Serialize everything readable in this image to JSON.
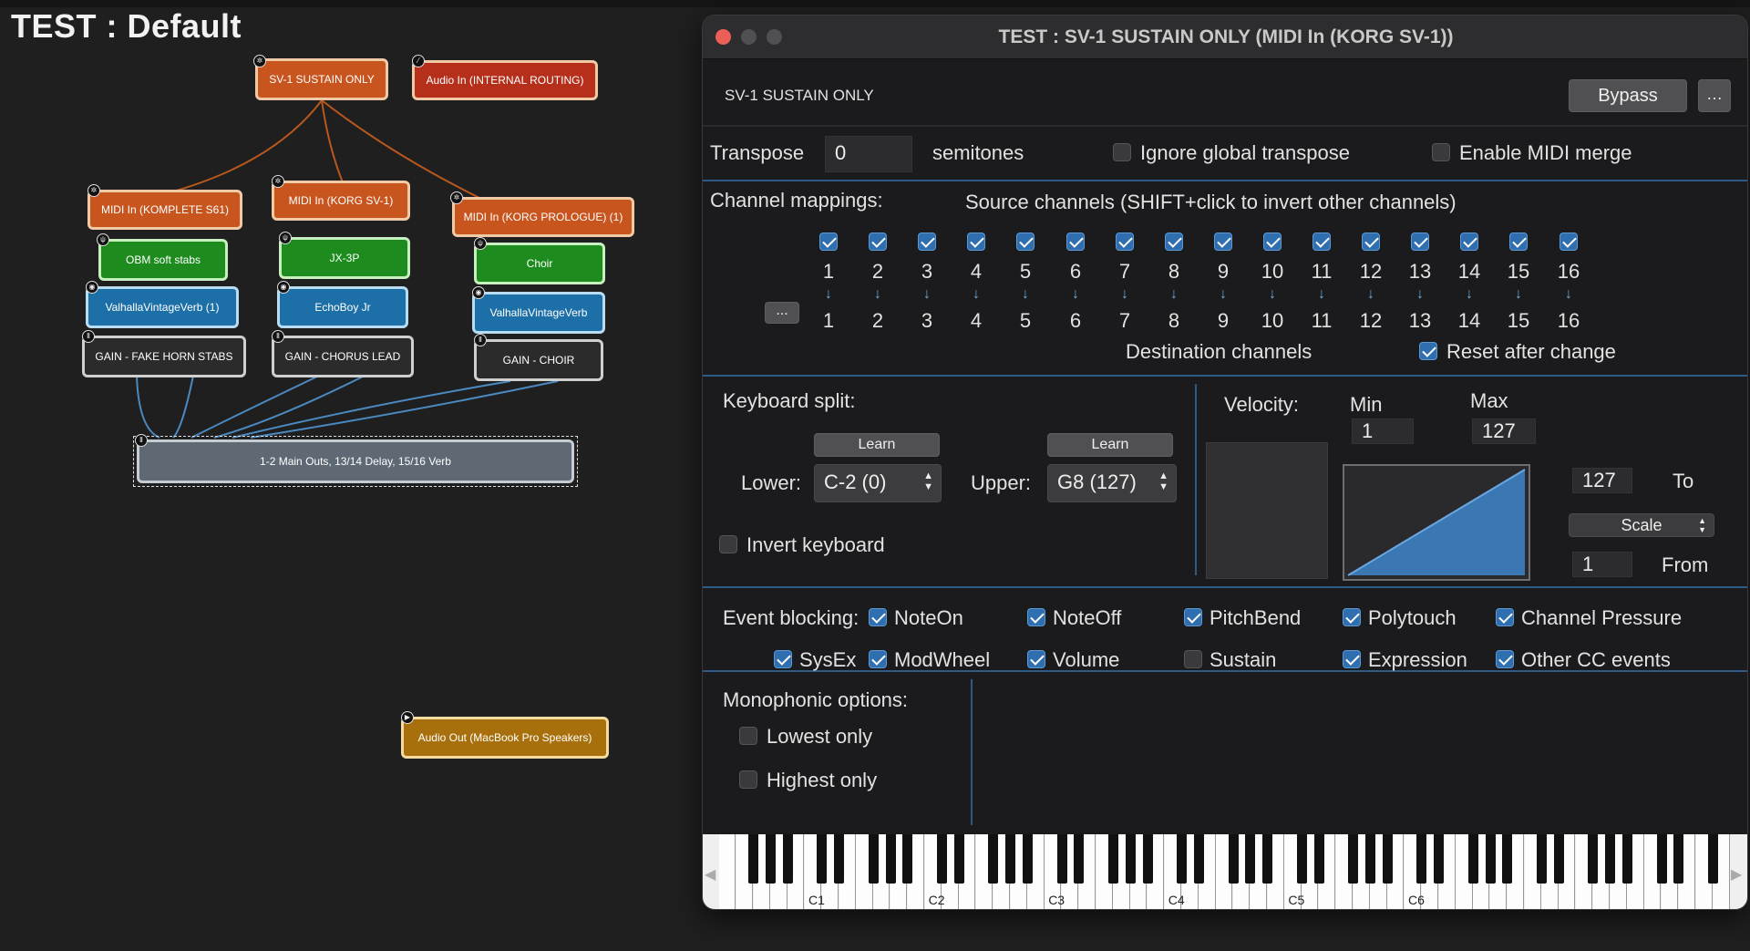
{
  "app": {
    "title": "TEST : Default"
  },
  "graph": {
    "nodes": {
      "sv1_sustain": "SV-1 SUSTAIN ONLY",
      "audio_in": "Audio In (INTERNAL ROUTING)",
      "midi_komplete": "MIDI In (KOMPLETE S61)",
      "midi_korg_sv1": "MIDI In (KORG SV-1)",
      "midi_prologue": "MIDI In (KORG PROLOGUE) (1)",
      "obm": "OBM soft stabs",
      "jx3p": "JX-3P",
      "choir": "Choir",
      "valhalla1": "ValhallaVintageVerb (1)",
      "echoboy": "EchoBoy Jr",
      "valhalla2": "ValhallaVintageVerb",
      "gain_horn": "GAIN - FAKE HORN STABS",
      "gain_chorus": "GAIN - CHORUS LEAD",
      "gain_choir": "GAIN - CHOIR",
      "main_outs": "1-2 Main Outs, 13/14 Delay, 15/16 Verb",
      "audio_out": "Audio Out (MacBook Pro Speakers)"
    }
  },
  "window": {
    "title": "TEST : SV-1 SUSTAIN ONLY (MIDI In (KORG SV-1))",
    "filter_name": "SV-1 SUSTAIN ONLY",
    "bypass_label": "Bypass",
    "more_label": "…"
  },
  "transpose": {
    "label": "Transpose",
    "value": "0",
    "unit": "semitones",
    "ignore_global_label": "Ignore global transpose",
    "ignore_global": false,
    "midi_merge_label": "Enable MIDI merge",
    "midi_merge": false
  },
  "channels": {
    "label": "Channel mappings:",
    "source_label": "Source channels (SHIFT+click to invert other channels)",
    "dest_label": "Destination channels",
    "reset_label": "Reset after change",
    "reset": true,
    "more_label": "...",
    "source": [
      "1",
      "2",
      "3",
      "4",
      "5",
      "6",
      "7",
      "8",
      "9",
      "10",
      "11",
      "12",
      "13",
      "14",
      "15",
      "16"
    ],
    "dest": [
      "1",
      "2",
      "3",
      "4",
      "5",
      "6",
      "7",
      "8",
      "9",
      "10",
      "11",
      "12",
      "13",
      "14",
      "15",
      "16"
    ],
    "enabled": [
      true,
      true,
      true,
      true,
      true,
      true,
      true,
      true,
      true,
      true,
      true,
      true,
      true,
      true,
      true,
      true
    ]
  },
  "split": {
    "label": "Keyboard split:",
    "learn_label": "Learn",
    "lower_label": "Lower:",
    "lower_value": "C-2 (0)",
    "upper_label": "Upper:",
    "upper_value": "G8 (127)",
    "invert_label": "Invert keyboard",
    "invert": false
  },
  "velocity": {
    "label": "Velocity:",
    "min_label": "Min",
    "max_label": "Max",
    "min": "1",
    "max": "127",
    "to_value": "127",
    "to_label": "To",
    "from_value": "1",
    "from_label": "From",
    "mode": "Scale"
  },
  "blocking": {
    "label": "Event blocking:",
    "items": [
      {
        "label": "NoteOn",
        "on": true
      },
      {
        "label": "NoteOff",
        "on": true
      },
      {
        "label": "PitchBend",
        "on": true
      },
      {
        "label": "Polytouch",
        "on": true
      },
      {
        "label": "Channel Pressure",
        "on": true
      },
      {
        "label": "SysEx",
        "on": true
      },
      {
        "label": "ModWheel",
        "on": true
      },
      {
        "label": "Volume",
        "on": true
      },
      {
        "label": "Sustain",
        "on": false
      },
      {
        "label": "Expression",
        "on": true
      },
      {
        "label": "Other CC events",
        "on": true
      }
    ]
  },
  "mono": {
    "label": "Monophonic options:",
    "lowest_label": "Lowest only",
    "lowest": false,
    "highest_label": "Highest only",
    "highest": false
  },
  "piano": {
    "octaves": [
      "C1",
      "C2",
      "C3",
      "C4",
      "C5",
      "C6"
    ]
  },
  "colors": {
    "accent": "#2f6fb0",
    "divider": "#2e5b86"
  }
}
